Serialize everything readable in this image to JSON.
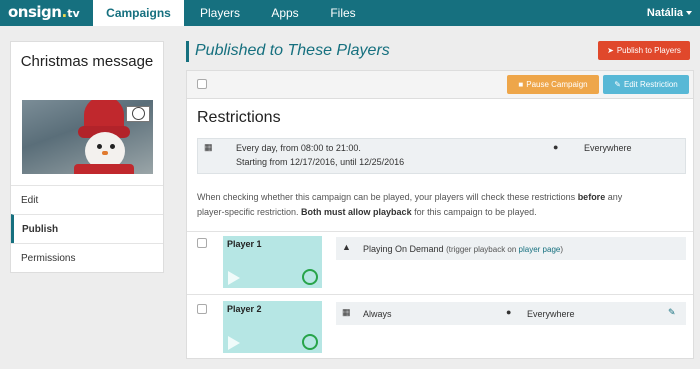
{
  "header": {
    "logo_main": "onsign",
    "logo_dot": ".",
    "logo_tv": "tv",
    "tabs": [
      {
        "label": "Campaigns",
        "active": true
      },
      {
        "label": "Players",
        "active": false
      },
      {
        "label": "Apps",
        "active": false
      },
      {
        "label": "Files",
        "active": false
      }
    ],
    "user_name": "Natália",
    "brand_color": "#16707f"
  },
  "sidebar": {
    "campaign_name": "Christmas message",
    "items": [
      {
        "label": "Edit",
        "active": false
      },
      {
        "label": "Publish",
        "active": true
      },
      {
        "label": "Permissions",
        "active": false
      }
    ]
  },
  "main": {
    "title": "Published to These Players",
    "publish_button": "Publish to Players",
    "pause_button": "Pause Campaign",
    "edit_restriction_button": "Edit Restriction",
    "restrictions_title": "Restrictions",
    "restriction_schedule": "Every day, from 08:00 to 21:00.",
    "restriction_dates": "Starting from 12/17/2016, until 12/25/2016",
    "restriction_location": "Everywhere",
    "note_part1": "When checking whether this campaign can be played, your players will check these restrictions ",
    "note_bold1": "before",
    "note_part2": " any",
    "note_part3": "player-specific restriction. ",
    "note_bold2": "Both must allow playback",
    "note_part4": " for this campaign to be played.",
    "players": [
      {
        "name": "Player 1",
        "status": "Playing On Demand",
        "status_note": "(trigger playback on ",
        "status_link": "player page",
        "status_note_end": ")"
      },
      {
        "name": "Player 2",
        "schedule": "Always",
        "location": "Everywhere"
      }
    ]
  },
  "colors": {
    "publish": "#e0482b",
    "pause": "#eea64a",
    "edit": "#58b8d6",
    "player_tile": "#b6e6e4",
    "online": "#27a44a"
  }
}
